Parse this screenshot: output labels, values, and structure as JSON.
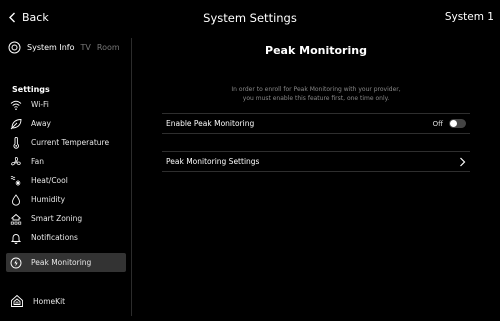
{
  "topbar": {
    "back_label": "Back",
    "title": "System Settings",
    "system_label": "System 1"
  },
  "sidebar": {
    "tabs": [
      {
        "label": "System Info",
        "active": true
      },
      {
        "label": "TV",
        "active": false
      },
      {
        "label": "Room",
        "active": false
      }
    ],
    "section_heading": "Settings",
    "items": [
      {
        "label": "Wi-Fi",
        "icon": "wifi-icon",
        "active": false
      },
      {
        "label": "Away",
        "icon": "leaf-icon",
        "active": false
      },
      {
        "label": "Current Temperature",
        "icon": "thermometer-icon",
        "active": false
      },
      {
        "label": "Fan",
        "icon": "fan-icon",
        "active": false
      },
      {
        "label": "Heat/Cool",
        "icon": "heat-cool-icon",
        "active": false
      },
      {
        "label": "Humidity",
        "icon": "droplet-icon",
        "active": false
      },
      {
        "label": "Smart Zoning",
        "icon": "house-zones-icon",
        "active": false
      },
      {
        "label": "Notifications",
        "icon": "bell-icon",
        "active": false
      },
      {
        "label": "Peak Monitoring",
        "icon": "lightning-circle-icon",
        "active": true
      }
    ],
    "homekit_label": "HomeKit"
  },
  "main": {
    "title": "Peak Monitoring",
    "description_line1": "In order to enroll for Peak Monitoring with your provider,",
    "description_line2": "you must enable this feature first, one time only.",
    "enable_row": {
      "label": "Enable Peak Monitoring",
      "state_label": "Off",
      "enabled": false
    },
    "settings_row": {
      "label": "Peak Monitoring Settings"
    }
  },
  "colors": {
    "background": "#000000",
    "active_item_bg": "#333333",
    "divider": "#2c2c2c",
    "muted_text": "#888888"
  }
}
